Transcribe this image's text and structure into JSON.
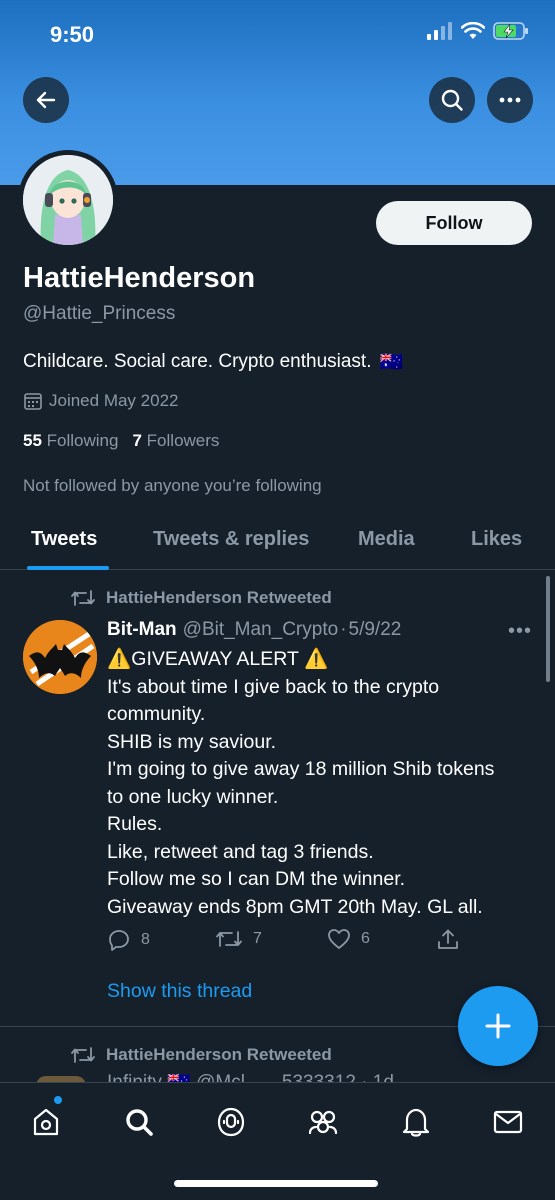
{
  "status_bar": {
    "time": "9:50"
  },
  "header": {
    "back_icon": "arrow-left-icon",
    "search_icon": "search-icon",
    "more_icon": "more-horizontal-icon"
  },
  "profile": {
    "display_name": "HattieHenderson",
    "handle": "@Hattie_Princess",
    "follow_label": "Follow",
    "bio": "Childcare. Social care. Crypto enthusiast.",
    "bio_flag": "🇦🇺",
    "joined": "Joined May 2022",
    "following_count": "55",
    "following_label": "Following",
    "followers_count": "7",
    "followers_label": "Followers",
    "not_followed": "Not followed by anyone you’re following"
  },
  "tabs": [
    {
      "label": "Tweets",
      "active": true
    },
    {
      "label": "Tweets & replies",
      "active": false
    },
    {
      "label": "Media",
      "active": false
    },
    {
      "label": "Likes",
      "active": false
    }
  ],
  "tweets": [
    {
      "retweet_label": "HattieHenderson Retweeted",
      "author_name": "Bit-Man",
      "author_handle": "@Bit_Man_Crypto",
      "separator": "·",
      "date": "5/9/22",
      "more": "•••",
      "lines": [
        "⚠️GIVEAWAY ALERT ⚠️",
        "It's about time I give back to the crypto",
        "community.",
        "SHIB is my saviour.",
        "I'm going to give away 18 million Shib tokens",
        "to one lucky winner.",
        "Rules.",
        "Like, retweet and tag 3 friends.",
        "Follow me so I can DM the winner.",
        "Giveaway ends 8pm GMT 20th May.  GL all."
      ],
      "replies": "8",
      "retweets": "7",
      "likes": "6",
      "show_thread": "Show this thread"
    },
    {
      "retweet_label": "HattieHenderson Retweeted",
      "partial_text": "Infinity 🇦🇺 @Mcl...... 5333312 · 1d"
    }
  ],
  "fab": {
    "icon": "plus-icon"
  },
  "bottom_nav": [
    {
      "icon": "home-icon"
    },
    {
      "icon": "search-icon"
    },
    {
      "icon": "spaces-icon"
    },
    {
      "icon": "communities-icon"
    },
    {
      "icon": "notifications-icon"
    },
    {
      "icon": "messages-icon"
    }
  ],
  "colors": {
    "background": "#15202b",
    "accent": "#1d9bf0",
    "muted": "#8b98a5",
    "banner": "#3b8fe0"
  }
}
